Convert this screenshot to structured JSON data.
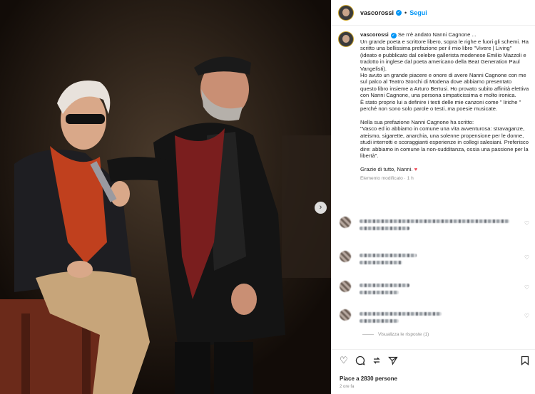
{
  "post": {
    "username": "vascorossi",
    "follow_label": "Segui",
    "dot": "•",
    "caption_lines": [
      "Se n'è andato Nanni Cagnone ...",
      "Un grande poeta e scrittore libero, sopra le righe e fuori gli schemi. Ha scritto una bellissima prefazione per il mio libro \"Vivere | Living\" (ideato e pubblicato dal celebre gallerista modenese Emilio Mazzoli e tradotto in inglese dal poeta americano della Beat Generation Paul Vangelisti).",
      "Ho avuto un grande piacere e onore di avere Nanni Cagnone con me sul palco al Teatro Storchi di Modena dove abbiamo presentato questo libro insieme a Arturo Bertusi. Ho provato subito affinità elettiva con Nanni Cagnone, una persona simpaticissima e molto ironica.",
      "È stato proprio lui a definire i testi delle mie canzoni come \" liriche \" perché non sono solo parole o testi..ma poesie musicate.",
      "",
      "Nella sua prefazione Nanni Cagnone ha scritto:",
      "\"Vasco ed io abbiamo in comune una vita avventurosa: stravaganze, ateismo, sigarette, anarchia, una solenne propensione per le donne, studi interrotti e scoraggianti esperienze in collegi salesiani. Preferisco dire: abbiamo in comune la non-sudditanza, ossia una passione per la libertà\".",
      "",
      "Grazie di tutto, Nanni."
    ],
    "heart": "♥",
    "meta": "Elemento modificato · 1 h",
    "view_replies": "Visualizza le risposte (1)",
    "likes": "Piace a 2830 persone",
    "time": "2 ore fa"
  },
  "icons": {
    "like": "heart-outline",
    "comment": "comment-bubble",
    "share": "paper-plane",
    "save": "bookmark",
    "next": "chevron-right"
  },
  "colors": {
    "accent": "#0095f6",
    "heart": "#ed4956"
  }
}
